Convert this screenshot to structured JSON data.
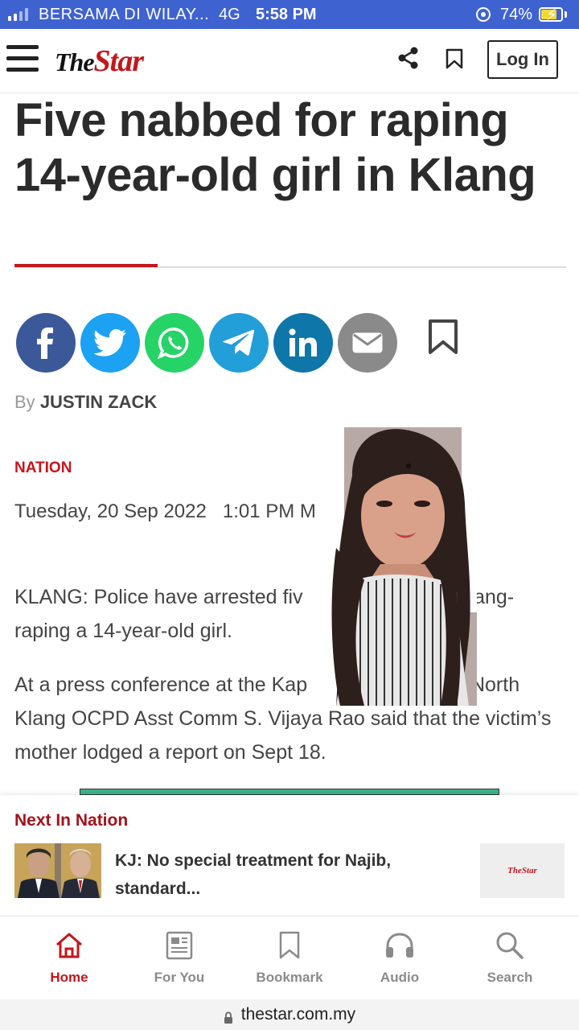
{
  "status_bar": {
    "carrier": "BERSAMA DI WILAY...",
    "network": "4G",
    "time": "5:58 PM",
    "battery_percent_label": "74%",
    "battery_level": 0.74,
    "icons": [
      "signal-icon",
      "rotation-lock-icon",
      "battery-charging-icon"
    ]
  },
  "header": {
    "logo_the": "The",
    "logo_star": "Star",
    "login_label": "Log In",
    "icons": [
      "menu-icon",
      "share-icon",
      "bookmark-icon"
    ]
  },
  "article": {
    "headline": "Five nabbed for raping 14-year-old girl in Klang",
    "share_buttons": [
      "facebook",
      "twitter",
      "whatsapp",
      "telegram",
      "linkedin",
      "email"
    ],
    "byline_prefix": "By",
    "author": "JUSTIN ZACK",
    "category": "NATION",
    "dateline": "Tuesday, 20 Sep 2022   1:01 PM M",
    "paragraph1": "KLANG: Police have arrested fiv                 egedly gang-raping a 14-year-old girl.",
    "paragraph2": "At a press conference at the Kap                 n here, North Klang OCPD Asst Comm S. Vijaya Rao said that the victim’s mother lodged a report on Sept 18."
  },
  "next_in_nation": {
    "title": "Next In Nation",
    "headline": "KJ: No special treatment for Najib, standard...",
    "logo_text": "TheStar"
  },
  "bottom_nav": {
    "items": [
      {
        "label": "Home",
        "icon": "home-icon",
        "active": true
      },
      {
        "label": "For You",
        "icon": "newspaper-icon",
        "active": false
      },
      {
        "label": "Bookmark",
        "icon": "bookmark-icon",
        "active": false
      },
      {
        "label": "Audio",
        "icon": "headphones-icon",
        "active": false
      },
      {
        "label": "Search",
        "icon": "search-icon",
        "active": false
      }
    ]
  },
  "url_bar": {
    "domain": "thestar.com.my"
  },
  "colors": {
    "brand_red": "#c4161c",
    "status_bar_blue": "#3f62d1",
    "facebook": "#3b5998",
    "twitter": "#1da1f2",
    "whatsapp": "#25d366",
    "telegram": "#229ed9",
    "linkedin": "#0e76a8",
    "email": "#8a8a8a"
  }
}
